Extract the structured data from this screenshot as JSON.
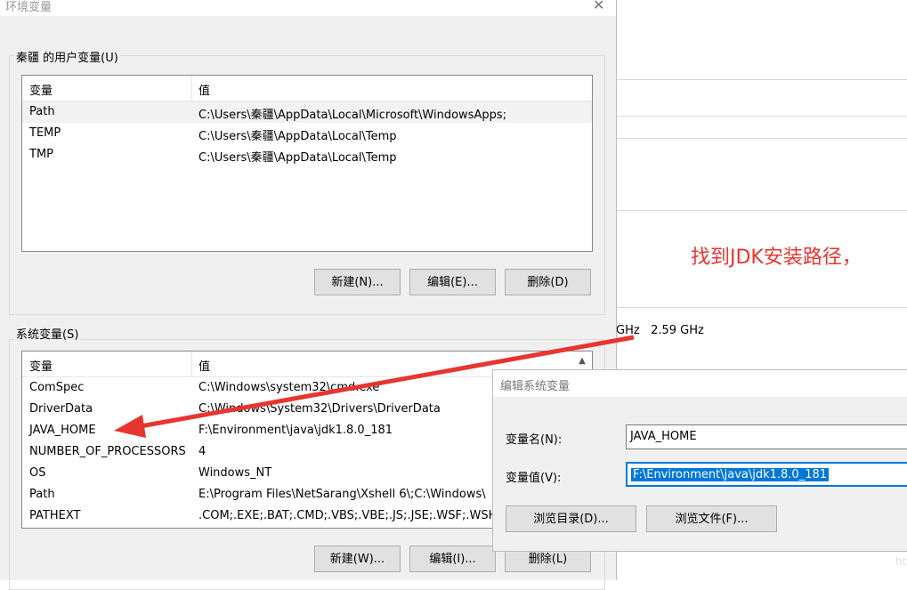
{
  "window_title": "环境变量",
  "close_glyph": "✕",
  "background": {
    "cpu_text": "GHz   2.59 GHz"
  },
  "user_vars": {
    "label": "秦疆 的用户变量(U)",
    "headers": [
      "变量",
      "值"
    ],
    "rows": [
      {
        "name": "Path",
        "value": "C:\\Users\\秦疆\\AppData\\Local\\Microsoft\\WindowsApps;"
      },
      {
        "name": "TEMP",
        "value": "C:\\Users\\秦疆\\AppData\\Local\\Temp"
      },
      {
        "name": "TMP",
        "value": "C:\\Users\\秦疆\\AppData\\Local\\Temp"
      }
    ],
    "buttons": {
      "new": "新建(N)...",
      "edit": "编辑(E)...",
      "delete": "删除(D)"
    }
  },
  "system_vars": {
    "label": "系统变量(S)",
    "headers": [
      "变量",
      "值"
    ],
    "rows": [
      {
        "name": "ComSpec",
        "value": "C:\\Windows\\system32\\cmd.exe"
      },
      {
        "name": "DriverData",
        "value": "C:\\Windows\\System32\\Drivers\\DriverData"
      },
      {
        "name": "JAVA_HOME",
        "value": "F:\\Environment\\java\\jdk1.8.0_181"
      },
      {
        "name": "NUMBER_OF_PROCESSORS",
        "value": "4"
      },
      {
        "name": "OS",
        "value": "Windows_NT"
      },
      {
        "name": "Path",
        "value": "E:\\Program Files\\NetSarang\\Xshell 6\\;C:\\Windows\\"
      },
      {
        "name": "PATHEXT",
        "value": ".COM;.EXE;.BAT;.CMD;.VBS;.VBE;.JS;.JSE;.WSF;.WSH;"
      }
    ],
    "buttons": {
      "new": "新建(W)...",
      "edit": "编辑(I)...",
      "delete": "删除(L)"
    }
  },
  "edit_dialog": {
    "title": "编辑系统变量",
    "name_label": "变量名(N):",
    "name_value": "JAVA_HOME",
    "value_label": "变量值(V):",
    "value_value": "F:\\Environment\\java\\jdk1.8.0_181",
    "browse_dir": "浏览目录(D)...",
    "browse_file": "浏览文件(F)..."
  },
  "annotation": {
    "text": "找到JDK安装路径，",
    "color": "#e8352f"
  },
  "watermark": "ht"
}
